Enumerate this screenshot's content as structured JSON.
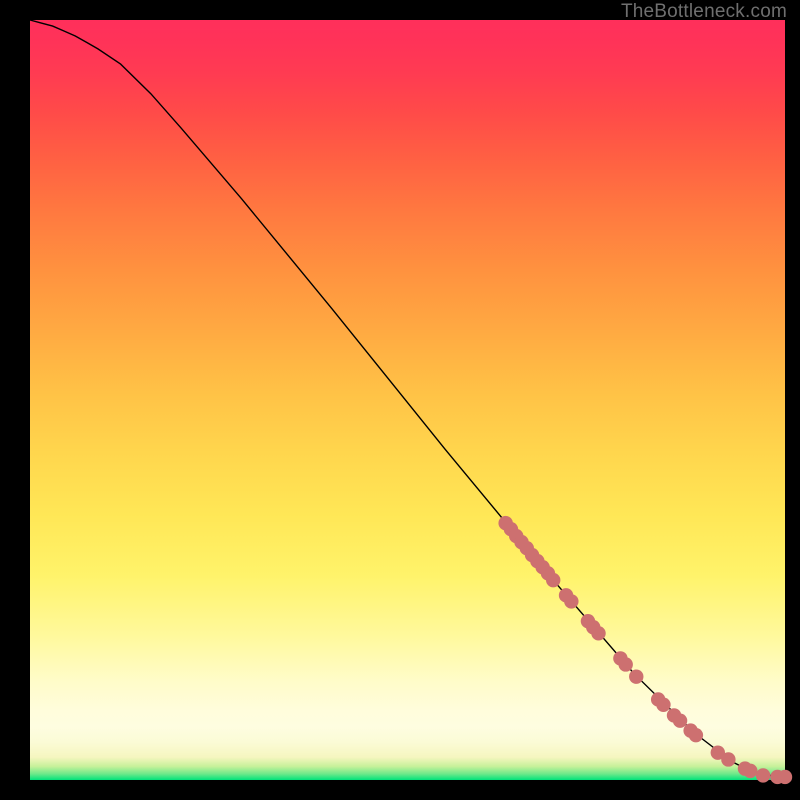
{
  "attribution": "TheBottleneck.com",
  "colors": {
    "scatter_fill": "#cd7070",
    "curve_stroke": "#000000",
    "gradient_top": "#ff2f5b",
    "gradient_bottom": "#00e27a"
  },
  "chart_data": {
    "type": "line",
    "title": "",
    "xlabel": "",
    "ylabel": "",
    "xlim": [
      0,
      100
    ],
    "ylim": [
      0,
      100
    ],
    "curve": {
      "x": [
        0,
        3,
        6,
        9,
        12,
        16,
        20,
        28,
        40,
        55,
        70,
        80,
        88,
        93,
        96,
        100
      ],
      "y": [
        100,
        99.2,
        97.9,
        96.2,
        94.2,
        90.3,
        85.8,
        76.5,
        62,
        43.5,
        25.5,
        14,
        6.2,
        2.4,
        0.9,
        0.3
      ]
    },
    "scatter_points": [
      {
        "x": 63.0,
        "y": 33.8
      },
      {
        "x": 63.7,
        "y": 33.0
      },
      {
        "x": 64.4,
        "y": 32.1
      },
      {
        "x": 65.1,
        "y": 31.3
      },
      {
        "x": 65.8,
        "y": 30.5
      },
      {
        "x": 66.5,
        "y": 29.6
      },
      {
        "x": 67.2,
        "y": 28.8
      },
      {
        "x": 67.9,
        "y": 28.0
      },
      {
        "x": 68.6,
        "y": 27.2
      },
      {
        "x": 69.3,
        "y": 26.3
      },
      {
        "x": 71.0,
        "y": 24.3
      },
      {
        "x": 71.7,
        "y": 23.5
      },
      {
        "x": 73.9,
        "y": 20.9
      },
      {
        "x": 74.6,
        "y": 20.1
      },
      {
        "x": 75.3,
        "y": 19.3
      },
      {
        "x": 78.2,
        "y": 16.0
      },
      {
        "x": 78.9,
        "y": 15.2
      },
      {
        "x": 80.3,
        "y": 13.6
      },
      {
        "x": 83.2,
        "y": 10.6
      },
      {
        "x": 83.9,
        "y": 9.9
      },
      {
        "x": 85.3,
        "y": 8.5
      },
      {
        "x": 86.1,
        "y": 7.8
      },
      {
        "x": 87.5,
        "y": 6.5
      },
      {
        "x": 88.2,
        "y": 5.9
      },
      {
        "x": 91.1,
        "y": 3.6
      },
      {
        "x": 92.5,
        "y": 2.7
      },
      {
        "x": 94.7,
        "y": 1.5
      },
      {
        "x": 95.4,
        "y": 1.2
      },
      {
        "x": 97.1,
        "y": 0.6
      },
      {
        "x": 99.0,
        "y": 0.4
      },
      {
        "x": 100.0,
        "y": 0.4
      }
    ],
    "scatter_radius": 7.2
  }
}
